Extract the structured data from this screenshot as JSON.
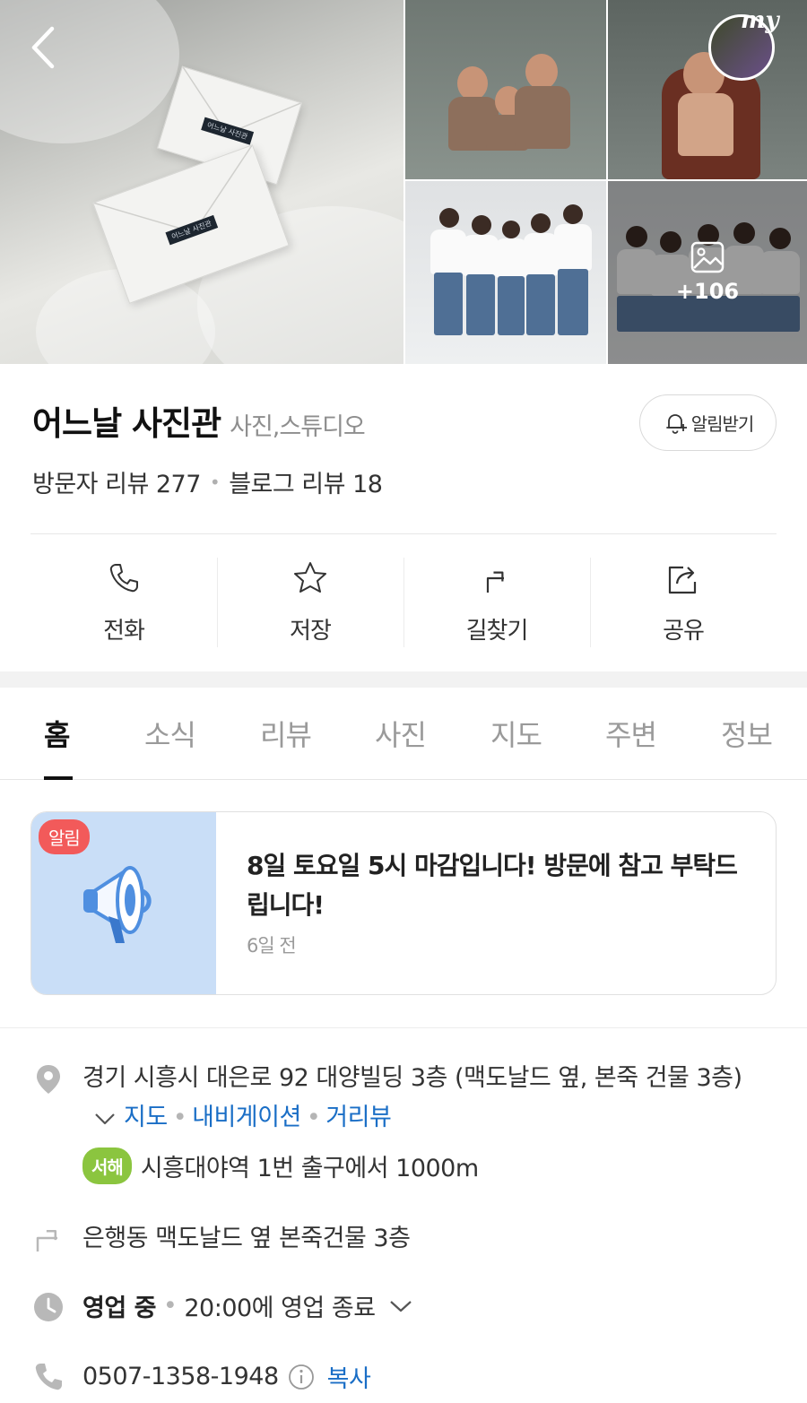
{
  "header": {
    "more_photos_count": "+106",
    "my_badge": "my"
  },
  "place": {
    "name": "어느날 사진관",
    "category": "사진,스튜디오",
    "alarm_label": "알림받기",
    "visitor_reviews": "방문자 리뷰 277",
    "blog_reviews": "블로그 리뷰 18"
  },
  "actions": [
    {
      "label": "전화",
      "icon": "phone-icon"
    },
    {
      "label": "저장",
      "icon": "star-icon"
    },
    {
      "label": "길찾기",
      "icon": "directions-icon"
    },
    {
      "label": "공유",
      "icon": "share-icon"
    }
  ],
  "tabs": [
    "홈",
    "소식",
    "리뷰",
    "사진",
    "지도",
    "주변",
    "정보"
  ],
  "active_tab": "홈",
  "notice": {
    "badge": "알림",
    "text": "8일 토요일 5시 마감입니다! 방문에 참고 부탁드립니다!",
    "time": "6일 전"
  },
  "info": {
    "address": "경기 시흥시 대은로 92 대양빌딩 3층 (맥도날드 옆, 본죽 건물 3층)",
    "address_links": [
      "지도",
      "내비게이션",
      "거리뷰"
    ],
    "subway_line": "서해",
    "subway_text": "시흥대야역 1번 출구에서 1000m",
    "directions": "은행동 맥도날드 옆 본죽건물 3층",
    "status": "영업 중",
    "hours": "20:00에 영업 종료",
    "phone": "0507-1358-1948",
    "copy_label": "복사"
  },
  "colors": {
    "link": "#1a6ec6",
    "notice_badge": "#f25a5a",
    "line_badge": "#8bc53f",
    "notice_bg": "#c9def7"
  }
}
